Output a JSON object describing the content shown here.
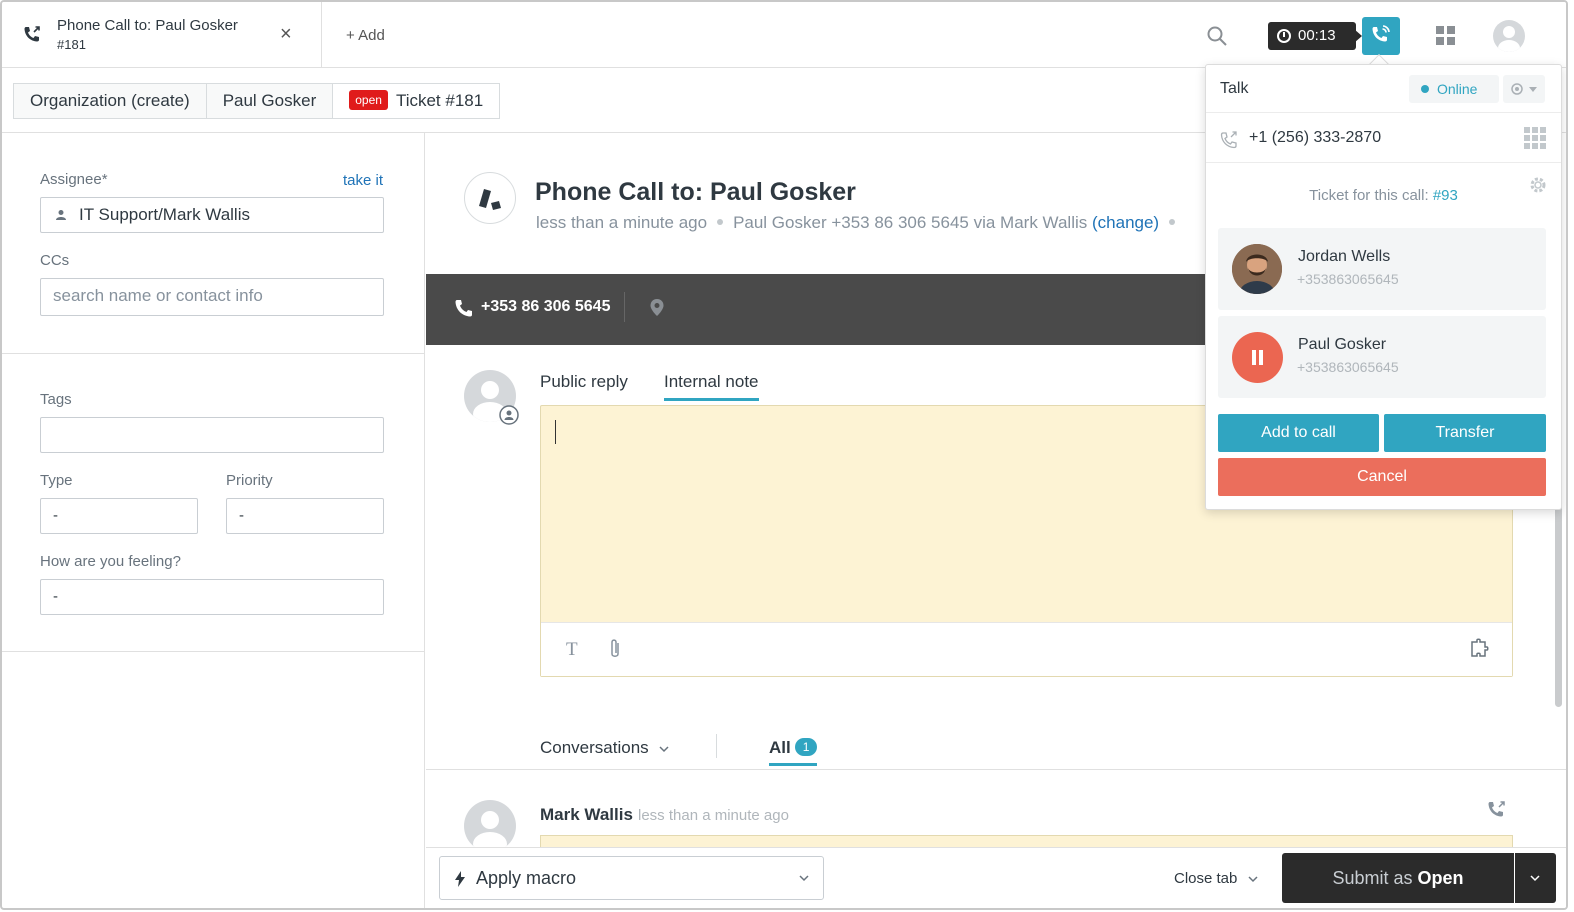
{
  "tab": {
    "title_line1": "Phone Call to: Paul Gosker",
    "title_line2": "#181",
    "close": "×"
  },
  "add_label": "+ Add",
  "timer": "00:13",
  "subtabs": {
    "org": "Organization (create)",
    "user": "Paul Gosker",
    "badge": "open",
    "ticket": "Ticket #181"
  },
  "sidebar": {
    "assignee_label": "Assignee*",
    "take_it": "take it",
    "assignee_value": "IT Support/Mark Wallis",
    "ccs_label": "CCs",
    "ccs_placeholder": "search name or contact info",
    "tags_label": "Tags",
    "type_label": "Type",
    "type_value": "-",
    "priority_label": "Priority",
    "priority_value": "-",
    "feeling_label": "How are you feeling?",
    "feeling_value": "-"
  },
  "ticket": {
    "title": "Phone Call to: Paul Gosker",
    "meta_time": "less than a minute ago",
    "meta_from": "Paul Gosker +353 86 306 5645 via Mark Wallis",
    "meta_change": "(change)"
  },
  "callbar": {
    "number": "+353 86 306 5645"
  },
  "composer": {
    "tab_public": "Public reply",
    "tab_internal": "Internal note",
    "tool_text": "T"
  },
  "conversations": {
    "label": "Conversations",
    "all": "All",
    "count": "1"
  },
  "message": {
    "author": "Mark Wallis",
    "time": "less than a minute ago"
  },
  "footer": {
    "macro": "Apply macro",
    "close_tab": "Close tab",
    "submit_prefix": "Submit as",
    "submit_status": "Open"
  },
  "talk": {
    "title": "Talk",
    "status": "Online",
    "number": "+1 (256) 333-2870",
    "ticket_for": "Ticket for this call:",
    "ticket_link": "#93",
    "party1_name": "Jordan Wells",
    "party1_phone": "+353863065645",
    "party2_name": "Paul Gosker",
    "party2_phone": "+353863065645",
    "add_to_call": "Add to call",
    "transfer": "Transfer",
    "cancel": "Cancel"
  },
  "colors": {
    "accent": "#30a5c1",
    "danger": "#eb6e5c",
    "open_badge": "#e01b1b",
    "dark": "#2b2b2b"
  }
}
